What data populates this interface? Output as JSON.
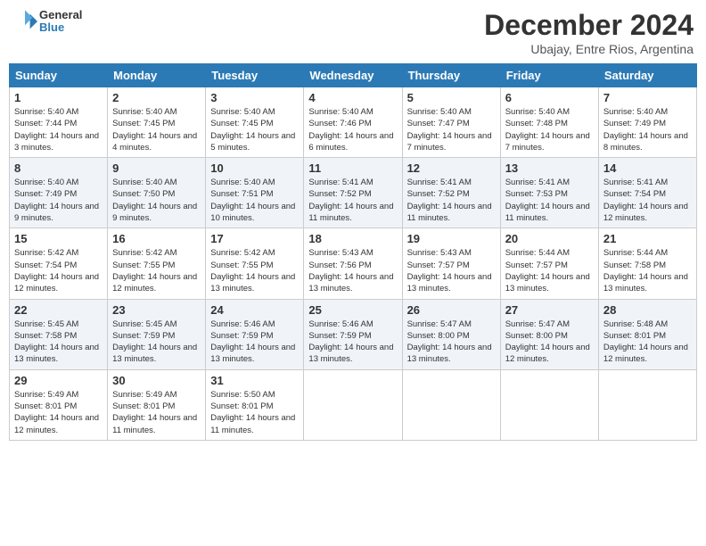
{
  "logo": {
    "line1": "General",
    "line2": "Blue"
  },
  "header": {
    "month": "December 2024",
    "location": "Ubajay, Entre Rios, Argentina"
  },
  "weekdays": [
    "Sunday",
    "Monday",
    "Tuesday",
    "Wednesday",
    "Thursday",
    "Friday",
    "Saturday"
  ],
  "weeks": [
    [
      {
        "day": "1",
        "rise": "5:40 AM",
        "set": "7:44 PM",
        "daylight": "14 hours and 3 minutes."
      },
      {
        "day": "2",
        "rise": "5:40 AM",
        "set": "7:45 PM",
        "daylight": "14 hours and 4 minutes."
      },
      {
        "day": "3",
        "rise": "5:40 AM",
        "set": "7:45 PM",
        "daylight": "14 hours and 5 minutes."
      },
      {
        "day": "4",
        "rise": "5:40 AM",
        "set": "7:46 PM",
        "daylight": "14 hours and 6 minutes."
      },
      {
        "day": "5",
        "rise": "5:40 AM",
        "set": "7:47 PM",
        "daylight": "14 hours and 7 minutes."
      },
      {
        "day": "6",
        "rise": "5:40 AM",
        "set": "7:48 PM",
        "daylight": "14 hours and 7 minutes."
      },
      {
        "day": "7",
        "rise": "5:40 AM",
        "set": "7:49 PM",
        "daylight": "14 hours and 8 minutes."
      }
    ],
    [
      {
        "day": "8",
        "rise": "5:40 AM",
        "set": "7:49 PM",
        "daylight": "14 hours and 9 minutes."
      },
      {
        "day": "9",
        "rise": "5:40 AM",
        "set": "7:50 PM",
        "daylight": "14 hours and 9 minutes."
      },
      {
        "day": "10",
        "rise": "5:40 AM",
        "set": "7:51 PM",
        "daylight": "14 hours and 10 minutes."
      },
      {
        "day": "11",
        "rise": "5:41 AM",
        "set": "7:52 PM",
        "daylight": "14 hours and 11 minutes."
      },
      {
        "day": "12",
        "rise": "5:41 AM",
        "set": "7:52 PM",
        "daylight": "14 hours and 11 minutes."
      },
      {
        "day": "13",
        "rise": "5:41 AM",
        "set": "7:53 PM",
        "daylight": "14 hours and 11 minutes."
      },
      {
        "day": "14",
        "rise": "5:41 AM",
        "set": "7:54 PM",
        "daylight": "14 hours and 12 minutes."
      }
    ],
    [
      {
        "day": "15",
        "rise": "5:42 AM",
        "set": "7:54 PM",
        "daylight": "14 hours and 12 minutes."
      },
      {
        "day": "16",
        "rise": "5:42 AM",
        "set": "7:55 PM",
        "daylight": "14 hours and 12 minutes."
      },
      {
        "day": "17",
        "rise": "5:42 AM",
        "set": "7:55 PM",
        "daylight": "14 hours and 13 minutes."
      },
      {
        "day": "18",
        "rise": "5:43 AM",
        "set": "7:56 PM",
        "daylight": "14 hours and 13 minutes."
      },
      {
        "day": "19",
        "rise": "5:43 AM",
        "set": "7:57 PM",
        "daylight": "14 hours and 13 minutes."
      },
      {
        "day": "20",
        "rise": "5:44 AM",
        "set": "7:57 PM",
        "daylight": "14 hours and 13 minutes."
      },
      {
        "day": "21",
        "rise": "5:44 AM",
        "set": "7:58 PM",
        "daylight": "14 hours and 13 minutes."
      }
    ],
    [
      {
        "day": "22",
        "rise": "5:45 AM",
        "set": "7:58 PM",
        "daylight": "14 hours and 13 minutes."
      },
      {
        "day": "23",
        "rise": "5:45 AM",
        "set": "7:59 PM",
        "daylight": "14 hours and 13 minutes."
      },
      {
        "day": "24",
        "rise": "5:46 AM",
        "set": "7:59 PM",
        "daylight": "14 hours and 13 minutes."
      },
      {
        "day": "25",
        "rise": "5:46 AM",
        "set": "7:59 PM",
        "daylight": "14 hours and 13 minutes."
      },
      {
        "day": "26",
        "rise": "5:47 AM",
        "set": "8:00 PM",
        "daylight": "14 hours and 13 minutes."
      },
      {
        "day": "27",
        "rise": "5:47 AM",
        "set": "8:00 PM",
        "daylight": "14 hours and 12 minutes."
      },
      {
        "day": "28",
        "rise": "5:48 AM",
        "set": "8:01 PM",
        "daylight": "14 hours and 12 minutes."
      }
    ],
    [
      {
        "day": "29",
        "rise": "5:49 AM",
        "set": "8:01 PM",
        "daylight": "14 hours and 12 minutes."
      },
      {
        "day": "30",
        "rise": "5:49 AM",
        "set": "8:01 PM",
        "daylight": "14 hours and 11 minutes."
      },
      {
        "day": "31",
        "rise": "5:50 AM",
        "set": "8:01 PM",
        "daylight": "14 hours and 11 minutes."
      },
      null,
      null,
      null,
      null
    ]
  ]
}
